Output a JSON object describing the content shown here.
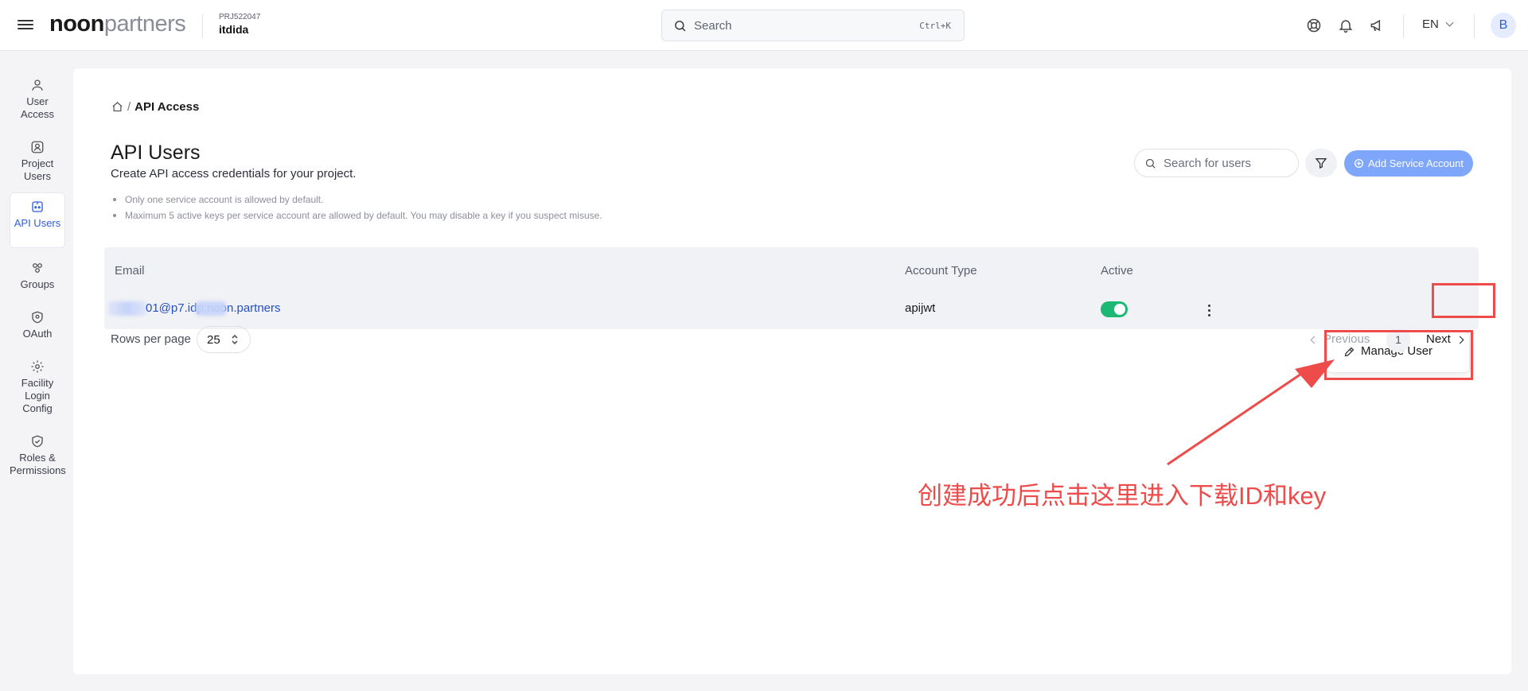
{
  "topbar": {
    "logo_bold": "noon",
    "logo_light": "partners",
    "project_code": "PRJ522047",
    "project_name": "itdida",
    "search_label": "Search",
    "search_shortcut": "Ctrl+K",
    "language": "EN",
    "avatar_initial": "B"
  },
  "sidebar": {
    "items": [
      {
        "label": "User Access",
        "icon": "user-icon"
      },
      {
        "label": "Project Users",
        "icon": "user-circle-icon"
      },
      {
        "label": "API Users",
        "icon": "api-icon",
        "active": true
      },
      {
        "label": "Groups",
        "icon": "groups-icon"
      },
      {
        "label": "OAuth",
        "icon": "shield-icon"
      },
      {
        "label": "Facility Login Config",
        "icon": "gear-icon"
      },
      {
        "label": "Roles & Permissions",
        "icon": "shield-check-icon"
      }
    ]
  },
  "breadcrumb": {
    "separator": "/",
    "current": "API Access"
  },
  "page": {
    "title": "API Users",
    "subtitle": "Create API access credentials for your project.",
    "notes": [
      "Only one service account is allowed by default.",
      "Maximum 5 active keys per service account are allowed by default. You may disable a key if you suspect misuse."
    ]
  },
  "toolbar": {
    "search_placeholder": "Search for users",
    "add_label": "Add Service Account"
  },
  "table": {
    "headers": {
      "email": "Email",
      "account_type": "Account Type",
      "active": "Active"
    },
    "rows": [
      {
        "email": "01@p7.idp.noon.partners",
        "account_type": "apijwt",
        "active": true
      }
    ]
  },
  "row_menu": {
    "manage_label": "Manage User"
  },
  "pagination": {
    "rows_per_page_label": "Rows per page",
    "rows_per_page": "25",
    "previous": "Previous",
    "current_page": "1",
    "next": "Next"
  },
  "annotation": {
    "text": "创建成功后点击这里进入下载ID和key",
    "color": "#ee4b4b"
  },
  "colors": {
    "primary": "#2f5fe0",
    "button": "#7ea6fb",
    "toggle_on": "#1db873",
    "link": "#2450c8"
  }
}
